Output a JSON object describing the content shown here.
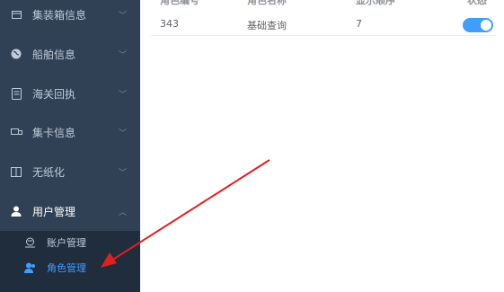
{
  "sidebar": {
    "items": [
      {
        "label": "集装箱信息",
        "icon": "container-icon"
      },
      {
        "label": "船舶信息",
        "icon": "globe-icon"
      },
      {
        "label": "海关回执",
        "icon": "receipt-icon"
      },
      {
        "label": "集卡信息",
        "icon": "truck-card-icon"
      },
      {
        "label": "无纸化",
        "icon": "book-icon"
      },
      {
        "label": "用户管理",
        "icon": "user-icon",
        "expanded": true
      }
    ],
    "submenu": [
      {
        "label": "账户管理",
        "icon": "account-icon"
      },
      {
        "label": "角色管理",
        "icon": "role-icon",
        "active": true
      }
    ]
  },
  "table": {
    "headers": [
      "角色编号",
      "角色名称",
      "显示顺序",
      "状态"
    ],
    "rows": [
      {
        "id": "343",
        "name": "基础查询",
        "order": "7",
        "status_on": true
      }
    ]
  },
  "colors": {
    "sidebar_bg": "#304156",
    "submenu_bg": "#1f2d3d",
    "accent": "#409eff",
    "annotation_arrow": "#e02020"
  }
}
